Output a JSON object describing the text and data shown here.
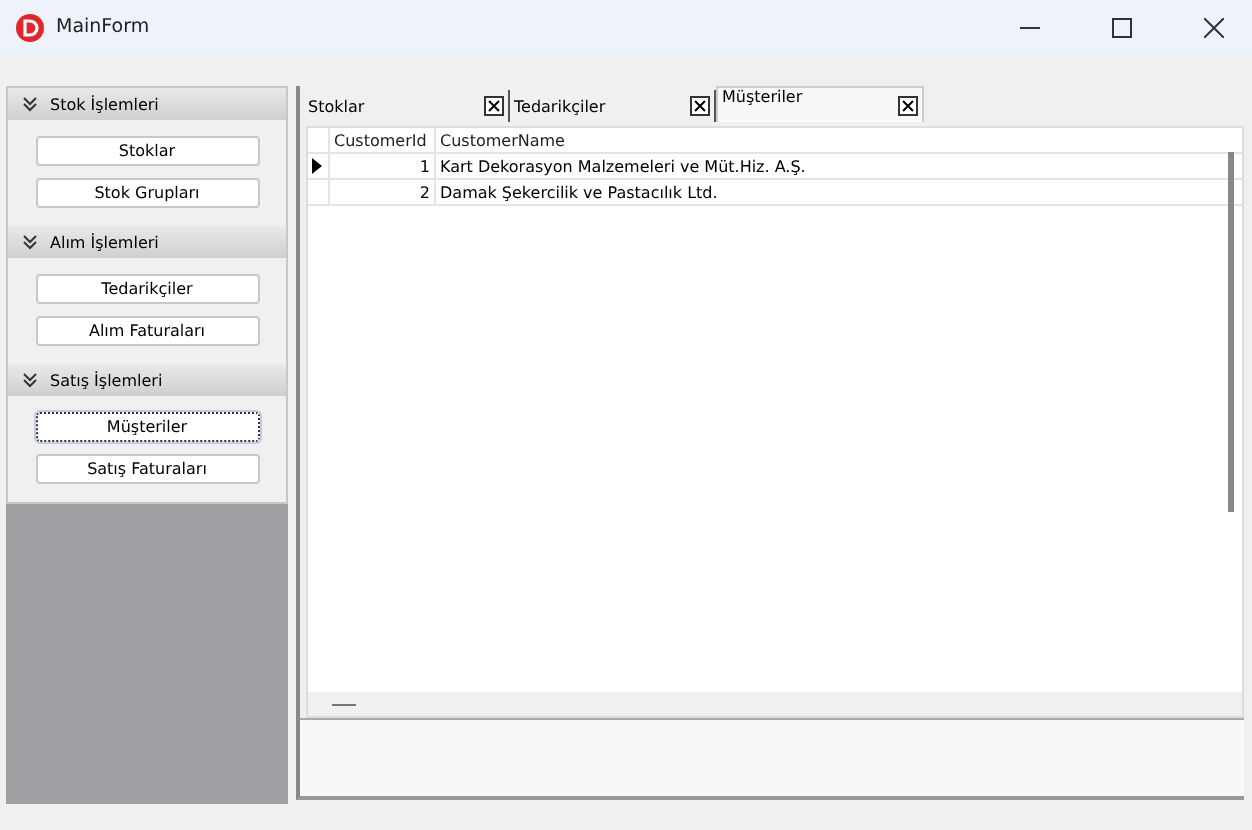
{
  "window": {
    "title": "MainForm"
  },
  "sidebar": {
    "groups": [
      {
        "title": "Stok İşlemleri",
        "expanded": true,
        "buttons": [
          {
            "label": "Stoklar",
            "focused": false
          },
          {
            "label": "Stok Grupları",
            "focused": false
          }
        ]
      },
      {
        "title": "Alım İşlemleri",
        "expanded": true,
        "buttons": [
          {
            "label": "Tedarikçiler",
            "focused": false
          },
          {
            "label": "Alım Faturaları",
            "focused": false
          }
        ]
      },
      {
        "title": "Satış İşlemleri",
        "expanded": true,
        "buttons": [
          {
            "label": "Müşteriler",
            "focused": true
          },
          {
            "label": "Satış Faturaları",
            "focused": false
          }
        ]
      }
    ]
  },
  "tabs": [
    {
      "label": "Stoklar",
      "selected": false
    },
    {
      "label": "Tedarikçiler",
      "selected": false
    },
    {
      "label": "Müşteriler",
      "selected": true
    }
  ],
  "table": {
    "columns": [
      "CustomerId",
      "CustomerName"
    ],
    "rows": [
      {
        "cells": [
          "1",
          "Kart Dekorasyon Malzemeleri ve Müt.Hiz. A.Ş."
        ],
        "selected": true
      },
      {
        "cells": [
          "2",
          "Damak Şekercilik ve Pastacılık Ltd."
        ],
        "selected": false
      }
    ]
  }
}
